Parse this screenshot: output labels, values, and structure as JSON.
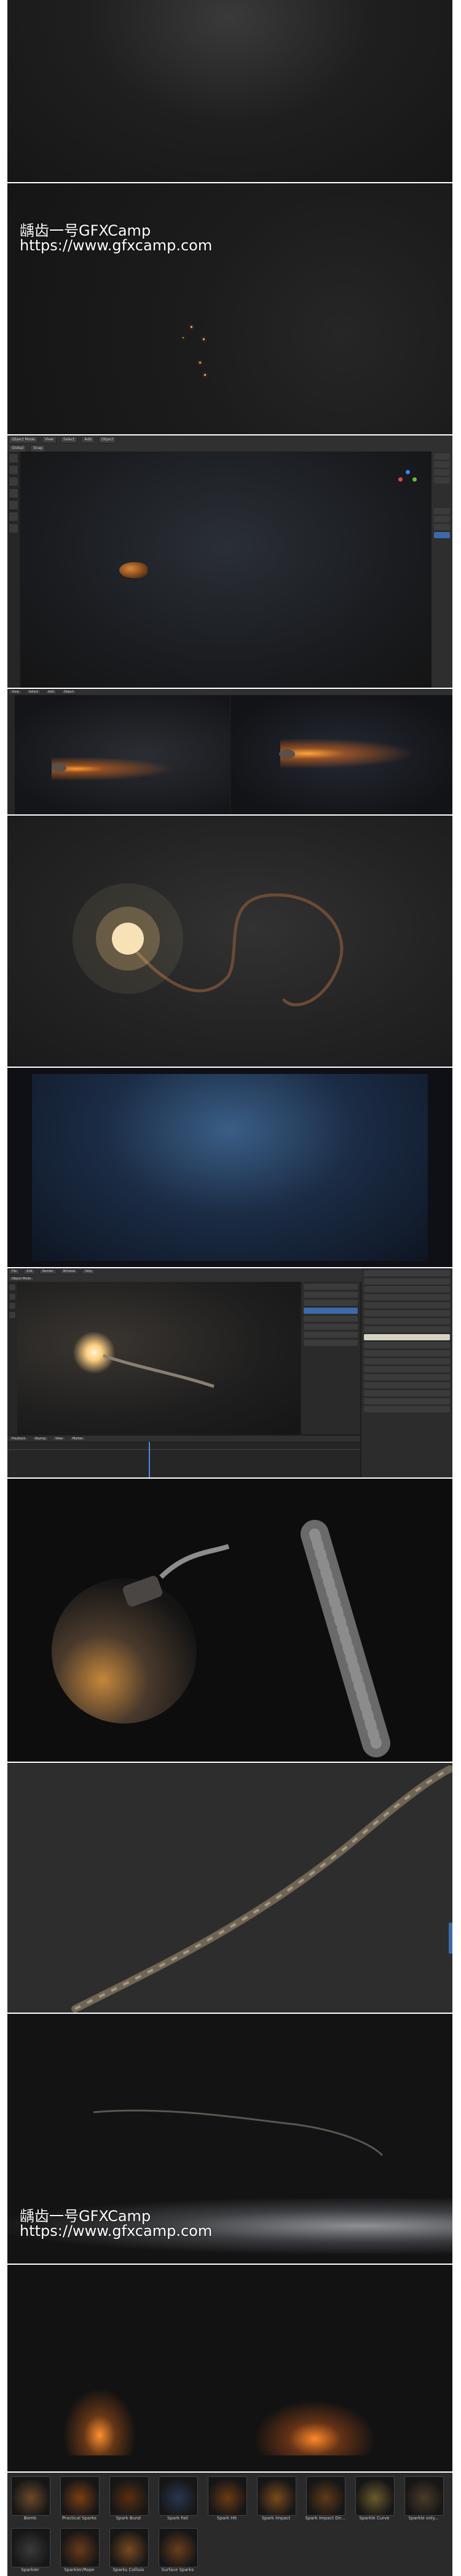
{
  "watermark": {
    "line1": "龋齿一号GFXCamp",
    "line2": "https://www.gfxcamp.com"
  },
  "viewport1": {
    "menu": [
      "Object Mode",
      "View",
      "Select",
      "Add",
      "Object"
    ],
    "header_right": [
      "Global",
      "Snap"
    ]
  },
  "viewport_split": {
    "menu": [
      "View",
      "Select",
      "Add",
      "Object"
    ]
  },
  "editor": {
    "menu": [
      "File",
      "Edit",
      "Render",
      "Window",
      "Help"
    ],
    "mode": "Object Mode",
    "timeline_menu": [
      "Playback",
      "Keying",
      "View",
      "Marker"
    ]
  },
  "library": {
    "items": [
      {
        "label": "Bomb"
      },
      {
        "label": "Practical Sparks"
      },
      {
        "label": "Spark Burst"
      },
      {
        "label": "Spark Fall"
      },
      {
        "label": "Spark Hit"
      },
      {
        "label": "Spark Impact"
      },
      {
        "label": "Spark Impact Dir..."
      },
      {
        "label": "Sparkle Curve"
      },
      {
        "label": "Sparkle only..."
      },
      {
        "label": "Sparkler"
      },
      {
        "label": "Sparkler/Rope"
      },
      {
        "label": "Sparks Collisio"
      },
      {
        "label": "Surface Sparks"
      }
    ]
  }
}
